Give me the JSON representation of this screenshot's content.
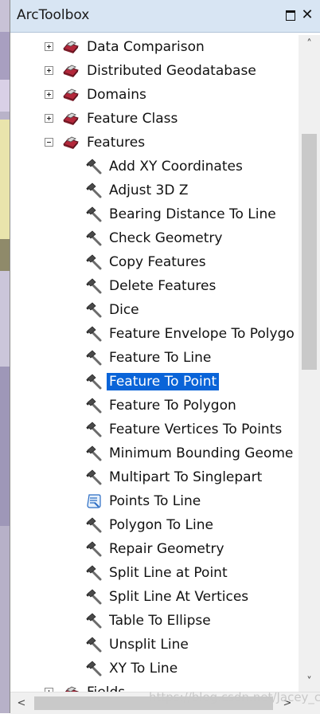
{
  "window": {
    "title": "ArcToolbox",
    "float_glyph": "□",
    "close_glyph": "✕"
  },
  "tree": {
    "toolsets": [
      {
        "label": "Data Comparison",
        "expanded": false
      },
      {
        "label": "Distributed Geodatabase",
        "expanded": false
      },
      {
        "label": "Domains",
        "expanded": false
      },
      {
        "label": "Feature Class",
        "expanded": false
      },
      {
        "label": "Features",
        "expanded": true
      }
    ],
    "tools": [
      {
        "label": "Add XY Coordinates",
        "icon": "hammer-icon"
      },
      {
        "label": "Adjust 3D Z",
        "icon": "hammer-icon"
      },
      {
        "label": "Bearing Distance To Line",
        "icon": "hammer-icon"
      },
      {
        "label": "Check Geometry",
        "icon": "hammer-icon"
      },
      {
        "label": "Copy Features",
        "icon": "hammer-icon"
      },
      {
        "label": "Delete Features",
        "icon": "hammer-icon"
      },
      {
        "label": "Dice",
        "icon": "hammer-icon"
      },
      {
        "label": "Feature Envelope To Polygo",
        "icon": "hammer-icon"
      },
      {
        "label": "Feature To Line",
        "icon": "hammer-icon"
      },
      {
        "label": "Feature To Point",
        "icon": "hammer-icon",
        "selected": true
      },
      {
        "label": "Feature To Polygon",
        "icon": "hammer-icon"
      },
      {
        "label": "Feature Vertices To Points",
        "icon": "hammer-icon"
      },
      {
        "label": "Minimum Bounding Geome",
        "icon": "hammer-icon"
      },
      {
        "label": "Multipart To Singlepart",
        "icon": "hammer-icon"
      },
      {
        "label": "Points To Line",
        "icon": "script-icon"
      },
      {
        "label": "Polygon To Line",
        "icon": "hammer-icon"
      },
      {
        "label": "Repair Geometry",
        "icon": "hammer-icon"
      },
      {
        "label": "Split Line at Point",
        "icon": "hammer-icon"
      },
      {
        "label": "Split Line At Vertices",
        "icon": "hammer-icon"
      },
      {
        "label": "Table To Ellipse",
        "icon": "hammer-icon"
      },
      {
        "label": "Unsplit Line",
        "icon": "hammer-icon"
      },
      {
        "label": "XY To Line",
        "icon": "hammer-icon"
      }
    ],
    "cut_off_label": "Fields"
  },
  "scrollbars": {
    "up": "˄",
    "down": "˅",
    "left": "<",
    "right": ">"
  },
  "watermark": "https://blog.csdn.net/Jacey_cai",
  "colors": {
    "titlebar": "#d8e5f3",
    "selection": "#0a64d8",
    "toolbox_red": "#b3273a"
  }
}
